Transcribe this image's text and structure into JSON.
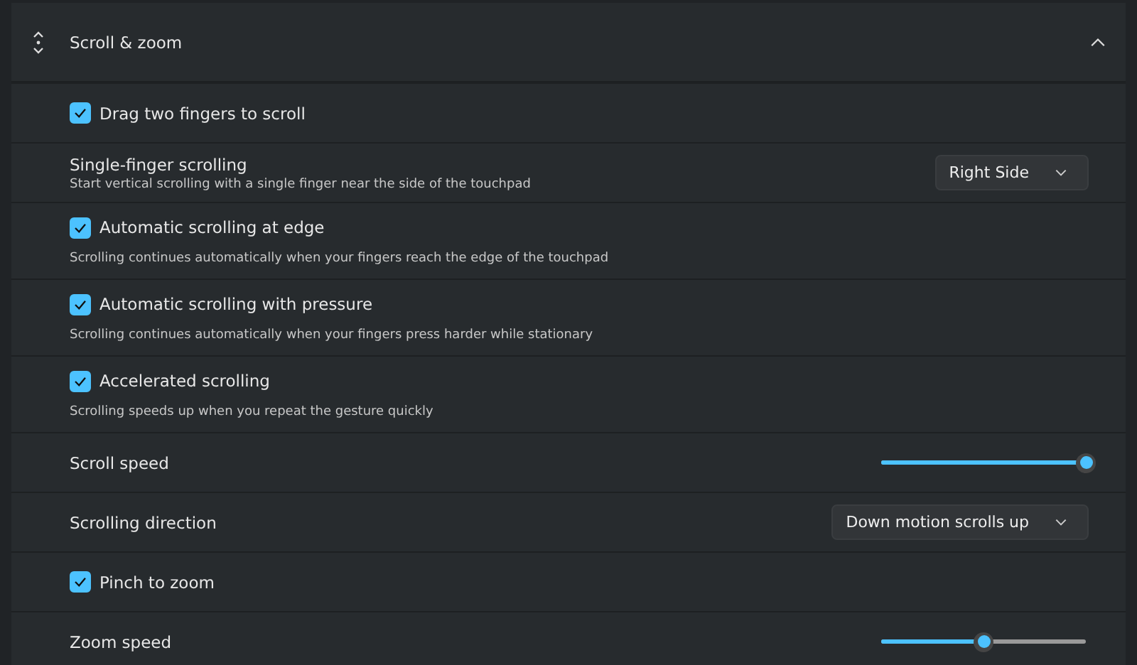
{
  "header": {
    "title": "Scroll & zoom",
    "expanded": true
  },
  "rows": [
    {
      "kind": "checkbox",
      "label": "Drag two fingers to scroll",
      "checked": true
    },
    {
      "kind": "dropdown",
      "label": "Single-finger scrolling",
      "description": "Start vertical scrolling with a single finger near the side of the touchpad",
      "value": "Right Side"
    },
    {
      "kind": "checkbox",
      "label": "Automatic scrolling at edge",
      "description": "Scrolling continues automatically when your fingers reach the edge of the touchpad",
      "checked": true
    },
    {
      "kind": "checkbox",
      "label": "Automatic scrolling with pressure",
      "description": "Scrolling continues automatically when your fingers press harder while stationary",
      "checked": true
    },
    {
      "kind": "checkbox",
      "label": "Accelerated scrolling",
      "description": "Scrolling speeds up when you repeat the gesture quickly",
      "checked": true
    },
    {
      "kind": "slider",
      "label": "Scroll speed",
      "level": 1.0
    },
    {
      "kind": "dropdown",
      "label": "Scrolling direction",
      "value": "Down motion scrolls up"
    },
    {
      "kind": "checkbox",
      "label": "Pinch to zoom",
      "checked": true
    },
    {
      "kind": "slider",
      "label": "Zoom speed",
      "level": 0.5
    }
  ]
}
